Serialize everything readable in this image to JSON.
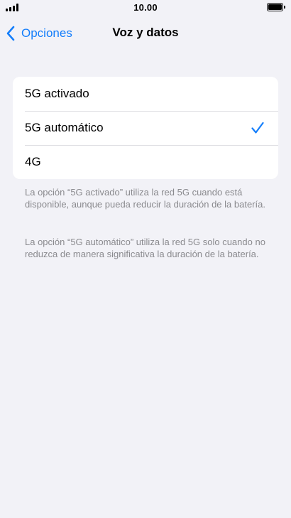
{
  "status_bar": {
    "time": "10.00",
    "signal_icon": "cellular-signal-icon",
    "battery_icon": "battery-full-icon",
    "battery_level": 1.0
  },
  "nav": {
    "back_label": "Opciones",
    "back_icon": "chevron-left-icon",
    "title": "Voz y datos"
  },
  "options": [
    {
      "label": "5G activado",
      "selected": false
    },
    {
      "label": "5G automático",
      "selected": true
    },
    {
      "label": "4G",
      "selected": false
    }
  ],
  "footnotes": [
    "La opción “5G activado” utiliza la red 5G cuando está disponible, aunque pueda reducir la duración de la batería.",
    "La opción “5G automático” utiliza la red 5G solo cuando no reduzca de manera significativa la duración de la batería."
  ],
  "colors": {
    "accent": "#147efb",
    "background": "#f2f2f7",
    "card": "#ffffff",
    "footnote_text": "#8a8a8e"
  }
}
